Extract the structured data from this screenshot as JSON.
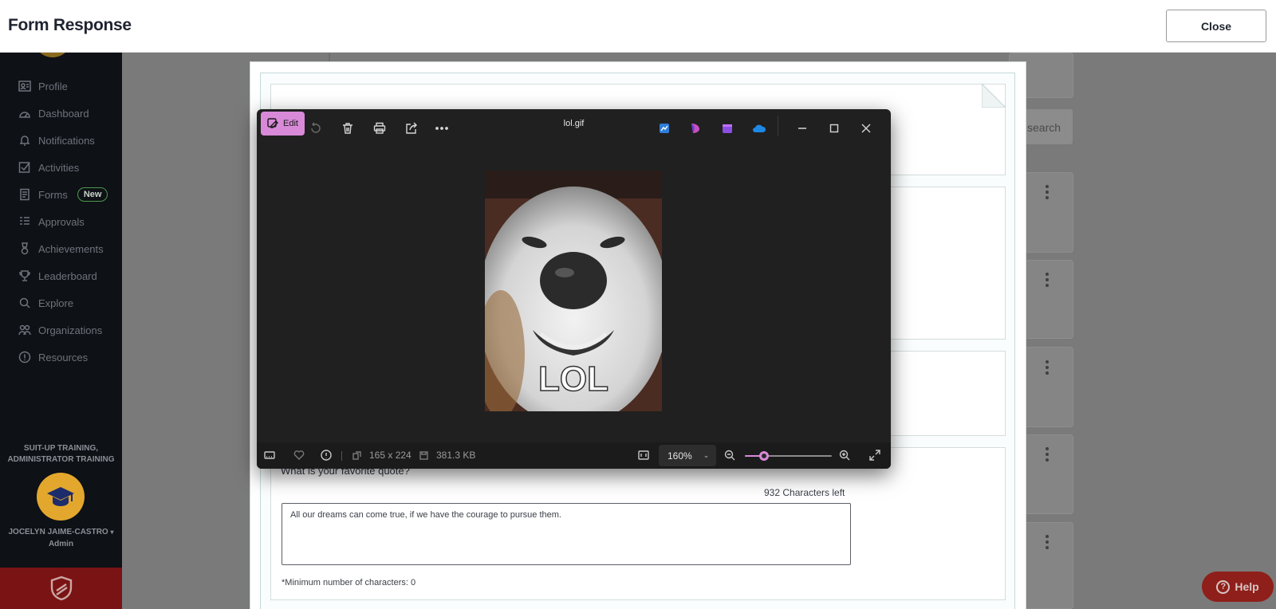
{
  "header": {
    "title": "Form Response",
    "close_label": "Close"
  },
  "sidebar": {
    "items": [
      {
        "label": "Profile",
        "icon": "profile-icon"
      },
      {
        "label": "Dashboard",
        "icon": "dashboard-icon"
      },
      {
        "label": "Notifications",
        "icon": "bell-icon"
      },
      {
        "label": "Activities",
        "icon": "checkbox-icon"
      },
      {
        "label": "Forms",
        "icon": "form-icon",
        "badge": "New"
      },
      {
        "label": "Approvals",
        "icon": "approvals-icon"
      },
      {
        "label": "Achievements",
        "icon": "medal-icon"
      },
      {
        "label": "Leaderboard",
        "icon": "trophy-icon"
      },
      {
        "label": "Explore",
        "icon": "explore-icon"
      },
      {
        "label": "Organizations",
        "icon": "people-icon"
      },
      {
        "label": "Resources",
        "icon": "info-icon"
      }
    ],
    "org_name": "SUIT-UP TRAINING, ADMINISTRATOR TRAINING",
    "user_name": "JOCELYN JAIME-CASTRO",
    "user_role": "Admin"
  },
  "background": {
    "search_label": "search"
  },
  "form": {
    "question": "What is your favorite quote?",
    "chars_left": "932 Characters left",
    "answer": "All our dreams can come true, if we have the courage to pursue them.",
    "min_chars": "*Minimum number of characters: 0"
  },
  "viewer": {
    "edit_label": "Edit",
    "file_name": "lol.gif",
    "image_text": "LOL",
    "dimensions": "165 x 224",
    "file_size": "381.3 KB",
    "zoom": "160%",
    "zoom_slider_level": 0.22,
    "accent": "#d88ad9"
  },
  "help": {
    "label": "Help"
  }
}
